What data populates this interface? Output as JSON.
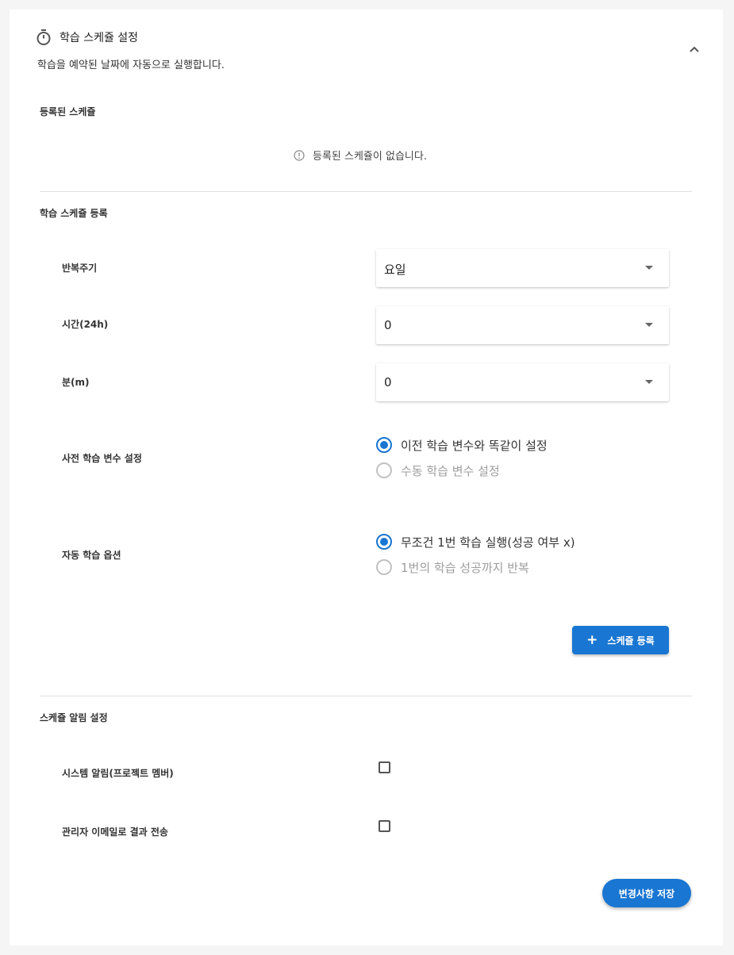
{
  "header": {
    "title": "학습 스케쥴 설정",
    "description": "학습을 예약된 날짜에 자동으로 실행합니다.",
    "icon": "stopwatch-icon",
    "collapse_icon": "chevron-up-icon"
  },
  "registered": {
    "title": "등록된 스케쥴",
    "empty_message": "등록된 스케쥴이 없습니다.",
    "icon": "info-icon"
  },
  "register_form": {
    "title": "학습 스케쥴 등록",
    "repeat": {
      "label": "반복주기",
      "value": "요일"
    },
    "hour": {
      "label": "시간(24h)",
      "value": "0"
    },
    "minute": {
      "label": "분(m)",
      "value": "0"
    },
    "pre_vars": {
      "label": "사전 학습 변수 설정",
      "options": [
        {
          "label": "이전 학습 변수와 똑같이 설정",
          "checked": true
        },
        {
          "label": "수동 학습 변수 설정",
          "checked": false
        }
      ]
    },
    "auto_option": {
      "label": "자동 학습 옵션",
      "options": [
        {
          "label": "무조건 1번 학습 실행(성공 여부 x)",
          "checked": true
        },
        {
          "label": "1번의 학습 성공까지 반복",
          "checked": false
        }
      ]
    },
    "register_button": "스케쥴 등록",
    "register_button_icon": "plus-icon"
  },
  "notification": {
    "title": "스케쥴 알림 설정",
    "system_alert": {
      "label": "시스템 알림(프로젝트 멤버)",
      "checked": false
    },
    "admin_email": {
      "label": "관리자 이메일로 결과 전송",
      "checked": false
    }
  },
  "save_button": "변경사항 저장",
  "colors": {
    "primary": "#1976d2",
    "background": "#f5f5f5",
    "card": "#ffffff",
    "disabled_text": "#9e9e9e"
  }
}
